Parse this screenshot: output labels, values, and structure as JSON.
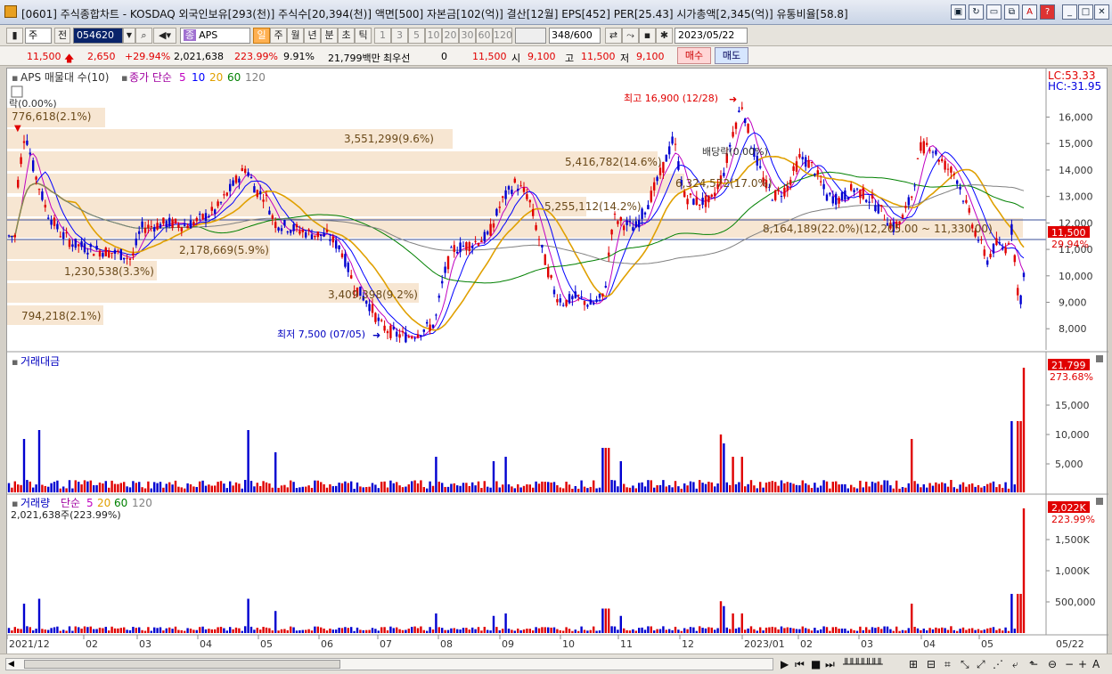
{
  "window": {
    "title": "[0601] 주식종합차트 - KOSDAQ 외국인보유[293(천)] 주식수[20,394(천)] 액면[500] 자본금[102(억)] 결산[12월] EPS[452] PER[25.43] 시가총액[2,345(억)] 유통비율[58.8]"
  },
  "toolbar": {
    "market": "주",
    "prev": "전",
    "code": "054620",
    "name": "APS",
    "periods": [
      "일",
      "주",
      "월",
      "년",
      "분",
      "초",
      "틱"
    ],
    "minutes": [
      "1",
      "3",
      "5",
      "10",
      "20",
      "30",
      "60",
      "120"
    ],
    "count": "348",
    "count_total": "/600",
    "date": "2023/05/22"
  },
  "quote": {
    "price": "11,500",
    "change": "2,650",
    "change_pct": "+29.94%",
    "volume": "2,021,638",
    "vol_ratio": "223.99%",
    "turnover": "9.91%",
    "amount": "21,799백만",
    "best": "최우선",
    "best_val": "0",
    "best_price": "11,500",
    "open_label": "시",
    "open": "9,100",
    "high_label": "고",
    "high": "11,500",
    "low_label": "저",
    "low": "9,100",
    "buy": "매수",
    "sell": "매도"
  },
  "panels": {
    "price_title": "APS 매물대 수(10)",
    "ma_label": "종가 단순",
    "ma_periods": [
      "5",
      "10",
      "20",
      "60",
      "120"
    ],
    "ma_colors": [
      "#c000c0",
      "#0000ff",
      "#e0a000",
      "#008000",
      "#808080"
    ],
    "rate_label": "락(0.00%)",
    "lc": "LC:53.33",
    "hc": "HC:-31.95",
    "amount_title": "거래대금",
    "amount_value": "21,799",
    "amount_pct": "273.68%",
    "volume_title": "거래량",
    "volume_ma_label": "단순",
    "volume_ma_periods": [
      "5",
      "20",
      "60",
      "120"
    ],
    "volume_now": "2,021,638주(223.99%)",
    "volume_value": "2,022K",
    "volume_pct": "223.99%"
  },
  "chart_data": {
    "type": "candlestick",
    "price_axis": [
      "16,000",
      "15,000",
      "14,000",
      "13,000",
      "12,000",
      "11,000",
      "10,000",
      "9,000",
      "8,000"
    ],
    "price_ylim": [
      7200,
      17700
    ],
    "last_price": "11,500",
    "last_pct": "29.94%",
    "x_labels": [
      "2021/12",
      "02",
      "03",
      "04",
      "05",
      "06",
      "07",
      "08",
      "09",
      "10",
      "11",
      "12",
      "2023/01",
      "02",
      "03",
      "04",
      "05",
      "05/22"
    ],
    "price_series": [
      [
        12,
        13500
      ],
      [
        20,
        15500
      ],
      [
        30,
        14000
      ],
      [
        45,
        12400
      ],
      [
        60,
        11600
      ],
      [
        75,
        11200
      ],
      [
        95,
        11000
      ],
      [
        115,
        10900
      ],
      [
        130,
        10800
      ],
      [
        140,
        10600
      ],
      [
        150,
        11800
      ],
      [
        165,
        11900
      ],
      [
        180,
        12000
      ],
      [
        200,
        11900
      ],
      [
        215,
        12100
      ],
      [
        235,
        12500
      ],
      [
        255,
        13500
      ],
      [
        268,
        14100
      ],
      [
        280,
        13200
      ],
      [
        290,
        13000
      ],
      [
        300,
        12000
      ],
      [
        320,
        11800
      ],
      [
        340,
        11600
      ],
      [
        360,
        11500
      ],
      [
        375,
        11000
      ],
      [
        390,
        9600
      ],
      [
        405,
        9000
      ],
      [
        420,
        8100
      ],
      [
        435,
        7800
      ],
      [
        450,
        7700
      ],
      [
        470,
        8000
      ],
      [
        480,
        8200
      ],
      [
        490,
        10000
      ],
      [
        500,
        11000
      ],
      [
        520,
        11200
      ],
      [
        540,
        11500
      ],
      [
        555,
        12800
      ],
      [
        570,
        13500
      ],
      [
        585,
        13000
      ],
      [
        600,
        11000
      ],
      [
        615,
        9300
      ],
      [
        625,
        9000
      ],
      [
        640,
        9200
      ],
      [
        655,
        8900
      ],
      [
        670,
        9200
      ],
      [
        680,
        12200
      ],
      [
        690,
        12000
      ],
      [
        705,
        11800
      ],
      [
        720,
        12800
      ],
      [
        735,
        14000
      ],
      [
        748,
        15200
      ],
      [
        760,
        13000
      ],
      [
        775,
        12800
      ],
      [
        790,
        12800
      ],
      [
        805,
        14000
      ],
      [
        815,
        15500
      ],
      [
        825,
        16500
      ],
      [
        835,
        15000
      ],
      [
        850,
        13500
      ],
      [
        860,
        13000
      ],
      [
        875,
        13300
      ],
      [
        890,
        14500
      ],
      [
        905,
        14100
      ],
      [
        920,
        13000
      ],
      [
        935,
        12900
      ],
      [
        950,
        13300
      ],
      [
        965,
        13000
      ],
      [
        980,
        12500
      ],
      [
        995,
        11800
      ],
      [
        1005,
        12200
      ],
      [
        1015,
        13000
      ],
      [
        1025,
        14800
      ],
      [
        1035,
        15000
      ],
      [
        1045,
        14500
      ],
      [
        1055,
        14100
      ],
      [
        1065,
        13800
      ],
      [
        1075,
        12800
      ],
      [
        1085,
        11800
      ],
      [
        1100,
        10600
      ],
      [
        1110,
        11200
      ],
      [
        1120,
        11000
      ],
      [
        1128,
        11800
      ],
      [
        1135,
        9200
      ],
      [
        1140,
        9100
      ],
      [
        1143,
        11500
      ]
    ],
    "annotations": [
      {
        "text": "776,618(2.1%)"
      },
      {
        "text": "3,551,299(9.6%)"
      },
      {
        "text": "5,416,782(14.6%)"
      },
      {
        "text": "6,324,572(17.0%)"
      },
      {
        "text": "5,255,112(14.2%)"
      },
      {
        "text": "8,164,189(22.0%)(12,205.00 ~ 11,330.00)"
      },
      {
        "text": "2,178,669(5.9%)"
      },
      {
        "text": "1,230,538(3.3%)"
      },
      {
        "text": "3,409,398(9.2%)"
      },
      {
        "text": "794,218(2.1%)"
      }
    ],
    "high_marker": "최고 16,900 (12/28)",
    "low_marker": "최저 7,500 (07/05)",
    "dividend": "배당락(0.00%)",
    "amount_axis": [
      "15,000",
      "10,000",
      "5,000"
    ],
    "volume_axis": [
      "1,500K",
      "1,000K",
      "500,000"
    ]
  },
  "statusbar": {
    "icons": [
      "first-icon",
      "prev-icon",
      "stop-icon",
      "next-icon",
      "zoom-out-icon",
      "zoom-in-icon"
    ]
  }
}
